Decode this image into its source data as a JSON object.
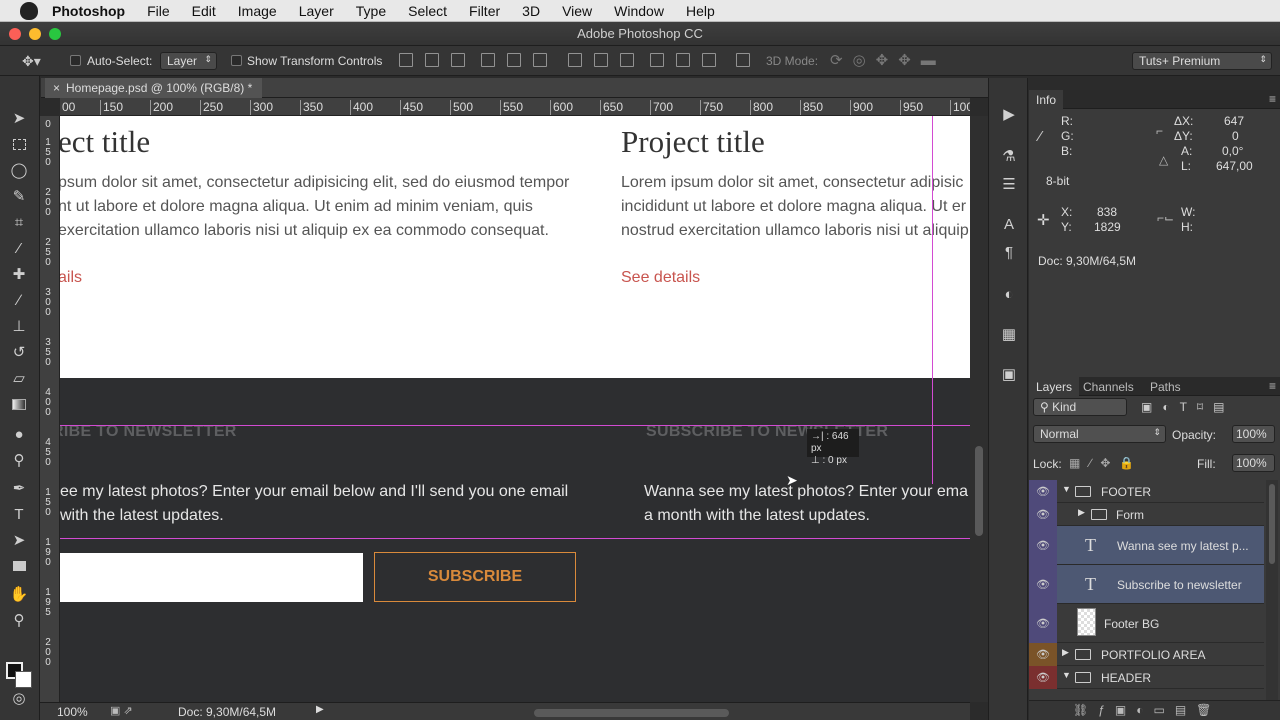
{
  "menubar": {
    "app_name": "Photoshop",
    "items": [
      "File",
      "Edit",
      "Image",
      "Layer",
      "Type",
      "Select",
      "Filter",
      "3D",
      "View",
      "Window",
      "Help"
    ]
  },
  "window": {
    "title": "Adobe Photoshop CC"
  },
  "options": {
    "auto_select_label": "Auto-Select:",
    "auto_select_value": "Layer",
    "transform_label": "Show Transform Controls",
    "mode3d_label": "3D Mode:",
    "workspace": "Tuts+ Premium"
  },
  "document": {
    "tab_title": "Homepage.psd @ 100% (RGB/8) *",
    "close_glyph": "×",
    "ruler_h": [
      "00",
      "150",
      "200",
      "250",
      "300",
      "350",
      "400",
      "450",
      "500",
      "550",
      "600",
      "650",
      "700",
      "750",
      "800",
      "850",
      "900",
      "950",
      "100"
    ],
    "ruler_v": [
      "0",
      "1 5 0",
      "2 0 0",
      "2 5 0",
      "3 0 0",
      "3 5 0",
      "4 0 0",
      "4 5 0",
      "1 5 0",
      "1 9 0",
      "1 9 5",
      "2 0 0"
    ]
  },
  "canvas": {
    "left_title": "ect title",
    "right_title": "Project title",
    "left_text": [
      "psum dolor sit amet, consectetur adipisicing elit, sed do eiusmod tempor",
      "nt ut labore et dolore magna aliqua. Ut enim ad minim veniam, quis",
      "exercitation ullamco laboris nisi ut aliquip ex ea commodo consequat."
    ],
    "right_text": [
      "Lorem ipsum dolor sit amet, consectetur adipisic",
      "incididunt ut labore et dolore magna aliqua. Ut er",
      "nostrud exercitation ullamco laboris nisi ut aliquip"
    ],
    "left_link": "ails",
    "right_link": "See details",
    "left_nl_head": "RIBE TO NEWSLETTER",
    "right_nl_head": "SUBSCRIBE TO NEWSLETTER",
    "left_nl_text": [
      "ee my latest photos? Enter your email below and I'll send you one email",
      "with the latest updates."
    ],
    "right_nl_text": [
      "Wanna see my latest photos? Enter your ema",
      "a month with the latest updates."
    ],
    "subscribe_label": "SUBSCRIBE",
    "measure_w": "→| : 646 px",
    "measure_h": "⊥ :   0 px"
  },
  "status": {
    "zoom": "100%",
    "doc": "Doc: 9,30M/64,5M"
  },
  "info": {
    "tab": "Info",
    "r": "R:",
    "g": "G:",
    "b": "B:",
    "bitdepth": "8-bit",
    "dx_label": "ΔX:",
    "dx": "647",
    "dy_label": "ΔY:",
    "dy": "0",
    "a_label": "A:",
    "a": "0,0°",
    "l_label": "L:",
    "l": "647,00",
    "x_label": "X:",
    "x": "838",
    "y_label": "Y:",
    "y": "1829",
    "w_label": "W:",
    "h_label": "H:",
    "doc": "Doc: 9,30M/64,5M"
  },
  "layers": {
    "tabs": [
      "Layers",
      "Channels",
      "Paths"
    ],
    "filter": "Kind",
    "blend": "Normal",
    "opacity_label": "Opacity:",
    "opacity": "100%",
    "lock_label": "Lock:",
    "fill_label": "Fill:",
    "fill": "100%",
    "rows": [
      {
        "name": "FOOTER",
        "type": "group-open"
      },
      {
        "name": "Form",
        "type": "group-closed"
      },
      {
        "name": "Wanna see my latest p...",
        "type": "text"
      },
      {
        "name": "Subscribe to newsletter",
        "type": "text"
      },
      {
        "name": "Footer BG",
        "type": "raster"
      },
      {
        "name": "PORTFOLIO AREA",
        "type": "group-closed"
      },
      {
        "name": "HEADER",
        "type": "group-open"
      }
    ],
    "colors": {
      "purple": "#4f4a7a",
      "orange": "#7a5328",
      "red": "#7a2f2f",
      "selected": "#4d5873"
    }
  },
  "colors": {
    "guide": "#d24bd2",
    "accent_link": "#c8554f",
    "subscribe": "#d98a3b",
    "footer_bg": "#2d2e30"
  }
}
